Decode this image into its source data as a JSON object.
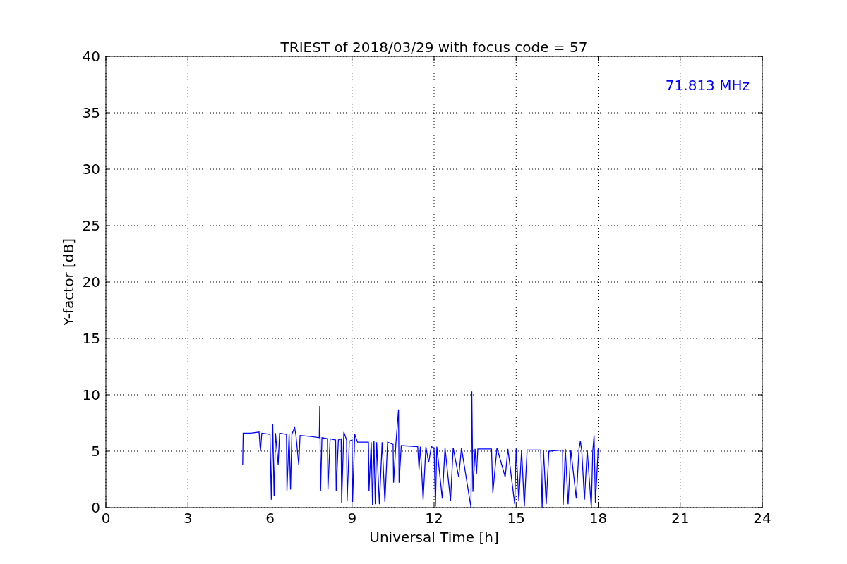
{
  "chart_data": {
    "type": "line",
    "title": "TRIEST of 2018/03/29 with focus code = 57",
    "xlabel": "Universal Time [h]",
    "ylabel": "Y-factor [dB]",
    "xlim": [
      0,
      24
    ],
    "ylim": [
      0,
      40
    ],
    "xticks": [
      0,
      3,
      6,
      9,
      12,
      15,
      18,
      21,
      24
    ],
    "yticks": [
      0,
      5,
      10,
      15,
      20,
      25,
      30,
      35,
      40
    ],
    "x": [
      5.0,
      5.02,
      5.3,
      5.6,
      5.65,
      5.7,
      6.0,
      6.05,
      6.1,
      6.15,
      6.2,
      6.3,
      6.35,
      6.6,
      6.62,
      6.7,
      6.75,
      6.8,
      6.9,
      6.95,
      7.05,
      7.1,
      7.5,
      7.8,
      7.82,
      7.85,
      7.9,
      8.1,
      8.12,
      8.2,
      8.4,
      8.42,
      8.5,
      8.6,
      8.62,
      8.7,
      8.8,
      8.82,
      8.9,
      9.0,
      9.02,
      9.1,
      9.2,
      9.6,
      9.62,
      9.7,
      9.75,
      9.8,
      9.85,
      9.9,
      10.0,
      10.1,
      10.2,
      10.3,
      10.5,
      10.52,
      10.6,
      10.7,
      10.72,
      10.8,
      11.4,
      11.45,
      11.5,
      11.6,
      11.7,
      11.8,
      11.9,
      12.0,
      12.05,
      12.1,
      12.3,
      12.4,
      12.6,
      12.7,
      12.9,
      13.0,
      13.35,
      13.38,
      13.42,
      13.5,
      13.55,
      13.6,
      14.1,
      14.15,
      14.3,
      14.6,
      14.7,
      14.95,
      15.0,
      15.1,
      15.2,
      15.3,
      15.4,
      15.9,
      15.95,
      16.0,
      16.1,
      16.2,
      16.7,
      16.72,
      16.8,
      16.9,
      17.0,
      17.2,
      17.3,
      17.35,
      17.4,
      17.5,
      17.6,
      17.75,
      17.8,
      17.85,
      17.9,
      18.0
    ],
    "series": [
      {
        "name": "71.813 MHz",
        "color": "#0000ff",
        "values": [
          3.8,
          6.6,
          6.6,
          6.7,
          5.0,
          6.6,
          6.5,
          0.7,
          7.4,
          1.0,
          6.6,
          3.8,
          6.6,
          6.5,
          1.5,
          6.5,
          1.6,
          6.5,
          7.1,
          6.4,
          3.8,
          6.4,
          6.3,
          6.2,
          9.0,
          1.5,
          6.2,
          6.1,
          1.6,
          6.1,
          6.0,
          1.5,
          6.0,
          6.1,
          0.4,
          6.7,
          6.0,
          0.6,
          5.9,
          6.0,
          0.5,
          6.5,
          5.8,
          5.8,
          1.5,
          5.8,
          0.2,
          5.9,
          0.3,
          5.8,
          0.3,
          5.8,
          0.5,
          5.8,
          5.6,
          2.2,
          5.6,
          8.7,
          2.2,
          5.5,
          5.4,
          3.4,
          5.4,
          0.7,
          5.4,
          4.0,
          5.4,
          5.3,
          0.1,
          5.4,
          0.8,
          5.3,
          0.6,
          5.3,
          2.7,
          5.3,
          0.0,
          10.3,
          1.4,
          5.2,
          3.0,
          5.2,
          5.2,
          1.3,
          5.3,
          2.7,
          5.2,
          0.3,
          5.2,
          0.6,
          5.1,
          0.1,
          5.1,
          5.1,
          0.0,
          5.1,
          0.3,
          5.0,
          5.1,
          0.2,
          5.2,
          0.3,
          5.1,
          0.8,
          5.2,
          5.9,
          5.0,
          0.7,
          5.1,
          0.0,
          5.0,
          6.4,
          0.4,
          5.2
        ]
      }
    ],
    "grid": true
  }
}
